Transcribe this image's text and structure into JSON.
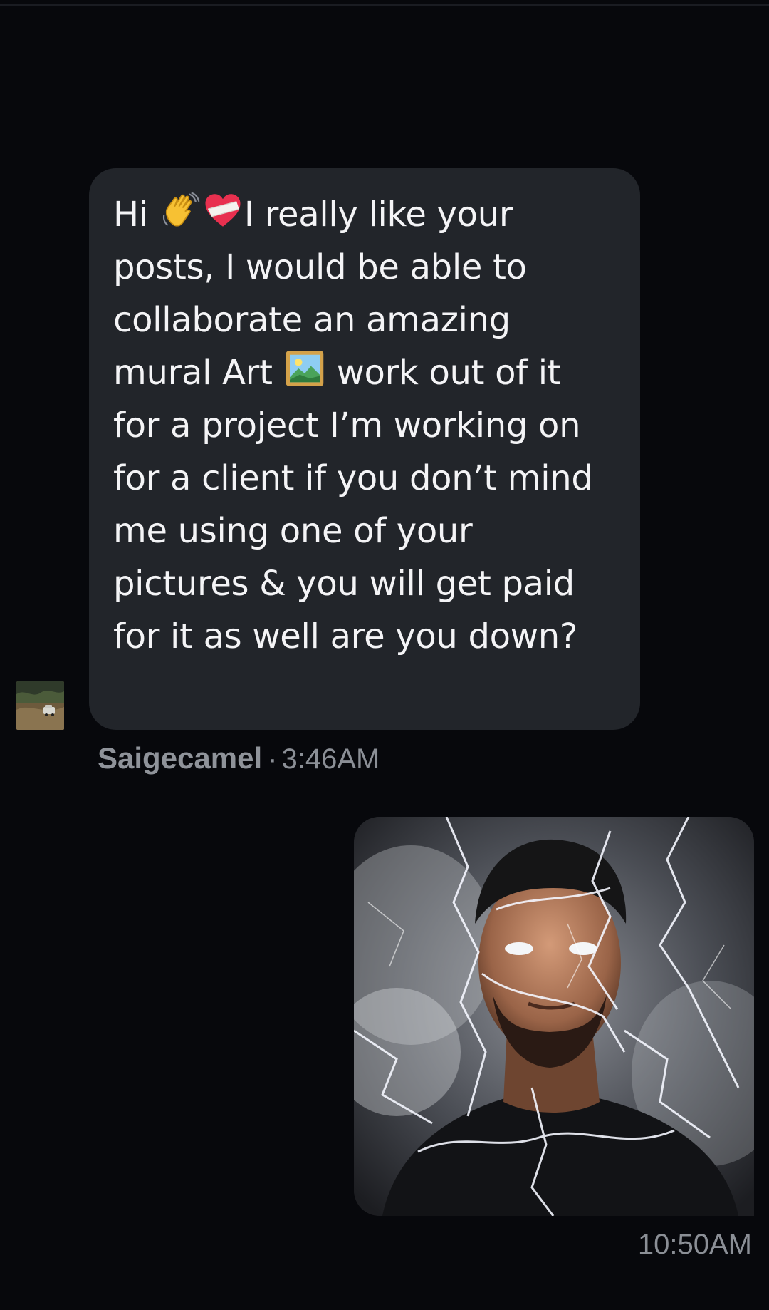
{
  "conversation": {
    "incoming_message": {
      "segments": {
        "s1": "Hi",
        "s2": "I really like your posts, I would be able to collaborate an amazing mural Art",
        "s3": "work out of it for a project I’m working on for a client if you don’t mind me using one of your pictures & you will get paid for it as well are you down?"
      },
      "emojis": [
        "waving-hand",
        "mending-heart",
        "framed-picture"
      ],
      "sender": "Saigecamel",
      "separator": "·",
      "time": "3:46AM"
    },
    "outgoing_message": {
      "type": "image",
      "image_description": "man with white eyes surrounded by lightning",
      "time": "10:50AM"
    }
  },
  "colors": {
    "background": "#07080c",
    "bubble": "#22252a",
    "meta_text": "#8b8f96"
  }
}
